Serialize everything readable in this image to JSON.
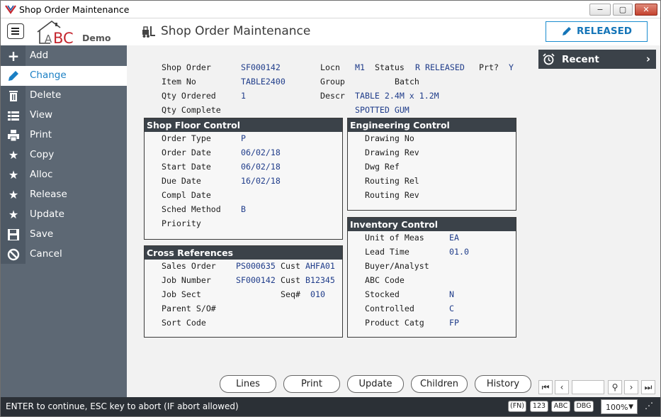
{
  "window": {
    "title": "Shop Order Maintenance",
    "min": "−",
    "max": "▢",
    "close": "✕"
  },
  "header": {
    "logo_text": "BC",
    "logo_suffix": "Demo",
    "title": "Shop Order Maintenance",
    "status_button": "RELEASED"
  },
  "sidebar": {
    "items": [
      {
        "label": "Add",
        "icon": "plus-icon"
      },
      {
        "label": "Change",
        "icon": "pencil-icon"
      },
      {
        "label": "Delete",
        "icon": "trash-icon"
      },
      {
        "label": "View",
        "icon": "list-icon"
      },
      {
        "label": "Print",
        "icon": "printer-icon"
      },
      {
        "label": "Copy",
        "icon": "star-icon"
      },
      {
        "label": "Alloc",
        "icon": "star-icon"
      },
      {
        "label": "Release",
        "icon": "star-icon"
      },
      {
        "label": "Update",
        "icon": "star-icon"
      },
      {
        "label": "Save",
        "icon": "floppy-icon"
      },
      {
        "label": "Cancel",
        "icon": "ban-icon"
      }
    ],
    "active": "Change"
  },
  "recent": {
    "label": "Recent"
  },
  "top": {
    "shop_order_label": "Shop Order",
    "shop_order": "SF000142",
    "locn_label": "Locn",
    "locn": "M1",
    "status_label": "Status",
    "status": "R RELEASED",
    "prt_label": "Prt?",
    "prt": "Y",
    "item_no_label": "Item No",
    "item_no": "TABLE2400",
    "group_label": "Group",
    "group": "Batch",
    "qty_ordered_label": "Qty Ordered",
    "qty_ordered": "1",
    "descr_label": "Descr",
    "descr1": "TABLE 2.4M x 1.2M",
    "descr2": "SPOTTED GUM",
    "qty_complete_label": "Qty Complete"
  },
  "shop_floor": {
    "title": "Shop Floor Control",
    "order_type_label": "Order Type",
    "order_type": "P",
    "order_date_label": "Order Date",
    "order_date": "06/02/18",
    "start_date_label": "Start Date",
    "start_date": "06/02/18",
    "due_date_label": "Due Date",
    "due_date": "16/02/18",
    "compl_date_label": "Compl Date",
    "sched_method_label": "Sched Method",
    "sched_method": "B",
    "priority_label": "Priority"
  },
  "engineering": {
    "title": "Engineering Control",
    "drawing_no_label": "Drawing No",
    "drawing_rev_label": "Drawing Rev",
    "dwg_ref_label": "Dwg Ref",
    "routing_rel_label": "Routing Rel",
    "routing_rev_label": "Routing Rev"
  },
  "cross_refs": {
    "title": "Cross References",
    "sales_order_label": "Sales Order",
    "sales_order": "PS000635",
    "cust1_label": "Cust",
    "cust1": "AHFA01",
    "job_number_label": "Job Number",
    "job_number": "SF000142",
    "cust2_label": "Cust",
    "cust2": "B12345",
    "job_sect_label": "Job Sect",
    "seq_label": "Seq#",
    "seq": "010",
    "parent_so_label": "Parent S/O#",
    "sort_code_label": "Sort Code"
  },
  "inventory": {
    "title": "Inventory Control",
    "uom_label": "Unit of Meas",
    "uom": "EA",
    "lead_time_label": "Lead Time",
    "lead_time": "01.0",
    "buyer_label": "Buyer/Analyst",
    "abc_label": "ABC Code",
    "stocked_label": "Stocked",
    "stocked": "N",
    "controlled_label": "Controlled",
    "controlled": "C",
    "product_catg_label": "Product Catg",
    "product_catg": "FP"
  },
  "buttons": {
    "lines": "Lines",
    "print": "Print",
    "update": "Update",
    "children": "Children",
    "history": "History"
  },
  "nav": {
    "first": "⏮",
    "prev": "‹",
    "search": "⚲",
    "next": "›",
    "last": "⏭"
  },
  "statusbar": {
    "message": "ENTER to continue, ESC key to abort (IF abort allowed)",
    "fn": "(FN)",
    "num": "123",
    "abc": "ABC",
    "dbg": "DBG",
    "zoom": "100%"
  },
  "colors": {
    "sidebar": "#5d6874",
    "accent": "#1a7fc4",
    "panel_header": "#3b4249",
    "value_text": "#1f3c8a"
  }
}
